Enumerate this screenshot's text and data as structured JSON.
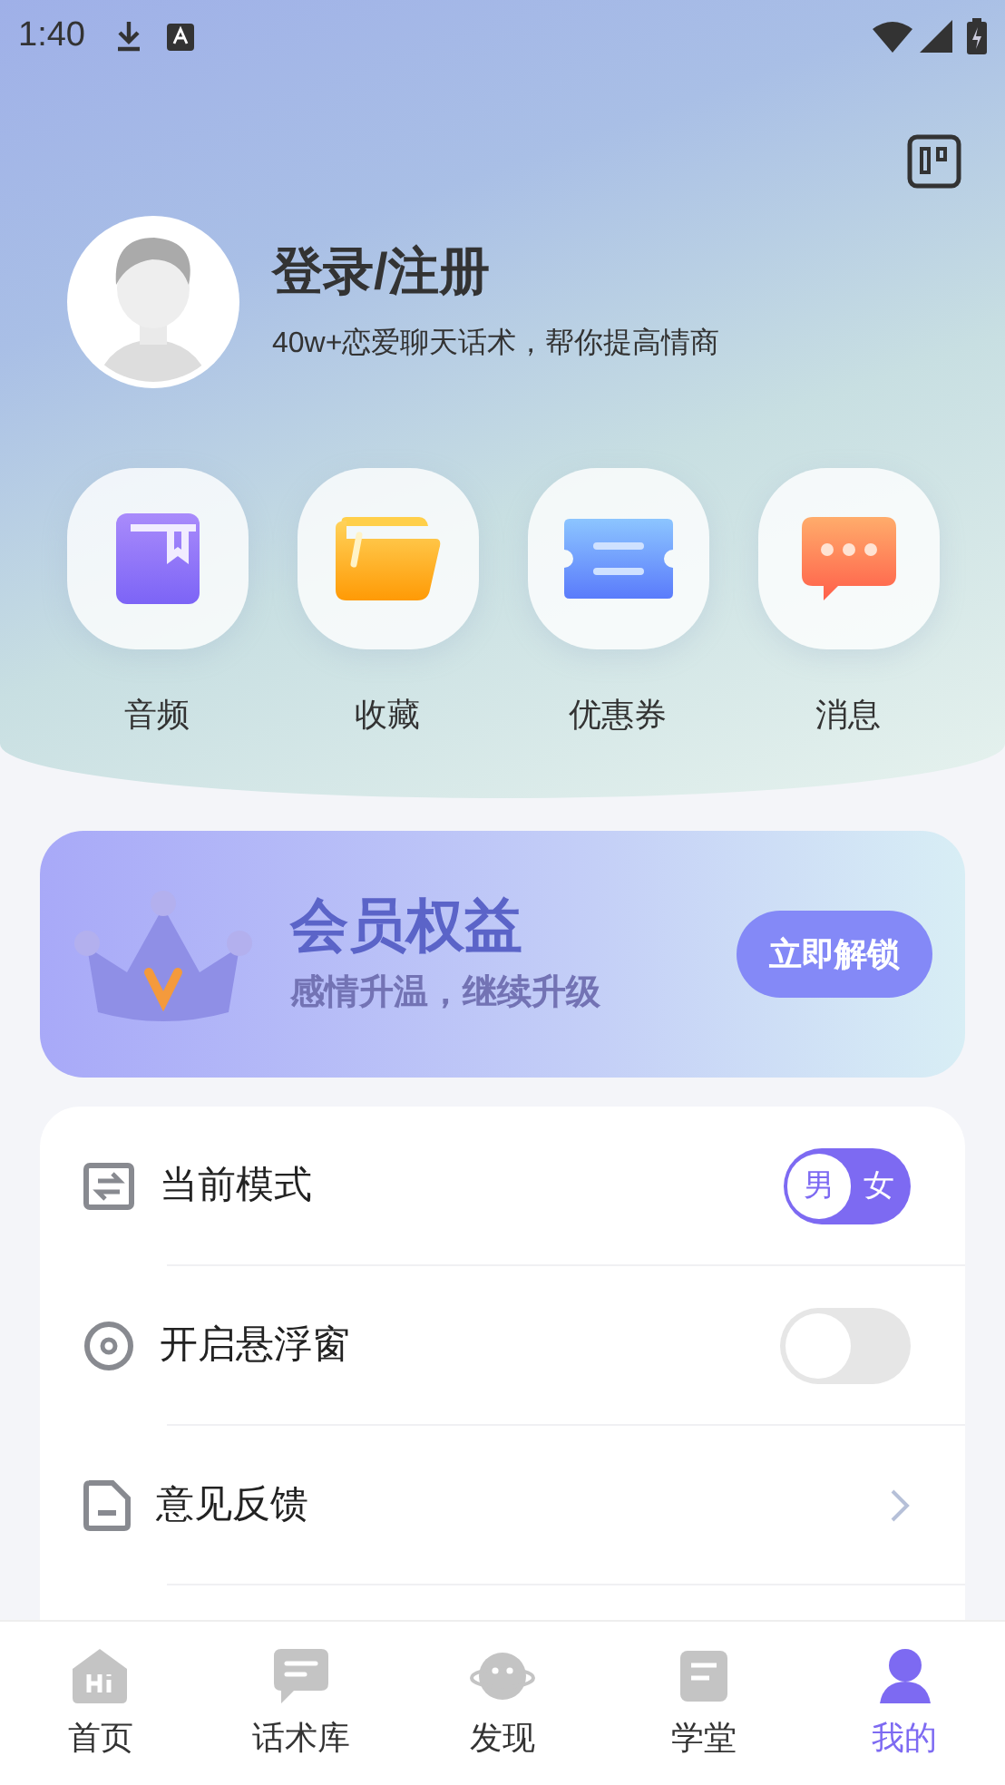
{
  "status_bar": {
    "time": "1:40"
  },
  "profile": {
    "title": "登录/注册",
    "subtitle": "40w+恋爱聊天话术，帮你提高情商"
  },
  "shortcuts": [
    {
      "kind": "book",
      "label": "音频"
    },
    {
      "kind": "folder",
      "label": "收藏"
    },
    {
      "kind": "ticket",
      "label": "优惠券"
    },
    {
      "kind": "message",
      "label": "消息"
    }
  ],
  "vip_banner": {
    "title": "会员权益",
    "subtitle": "感情升温，继续升级",
    "button": "立即解锁"
  },
  "settings": [
    {
      "kind": "mode",
      "label": "当前模式",
      "options": [
        {
          "label": "男",
          "selected": true
        },
        {
          "label": "女",
          "selected": false
        }
      ]
    },
    {
      "kind": "switch",
      "label": "开启悬浮窗",
      "on": false
    },
    {
      "kind": "link",
      "label": "意见反馈"
    }
  ],
  "bottom_nav": [
    {
      "kind": "home",
      "label": "首页",
      "selected": false
    },
    {
      "kind": "chat",
      "label": "话术库",
      "selected": false
    },
    {
      "kind": "planet",
      "label": "发现",
      "selected": false
    },
    {
      "kind": "school",
      "label": "学堂",
      "selected": false
    },
    {
      "kind": "user",
      "label": "我的",
      "selected": true
    }
  ]
}
